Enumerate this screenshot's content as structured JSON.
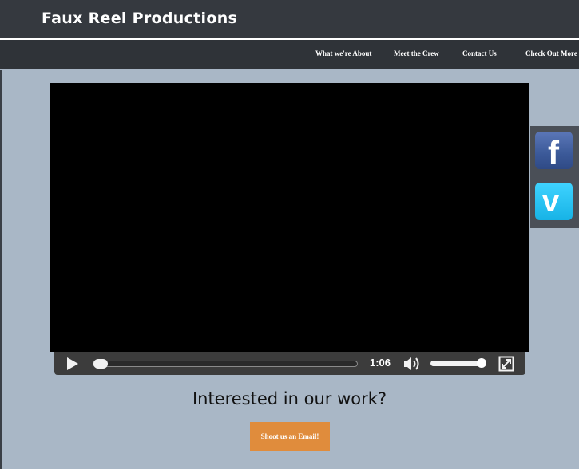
{
  "header": {
    "brand": "Faux Reel Productions"
  },
  "nav": {
    "items": [
      {
        "label": "What we're About"
      },
      {
        "label": "Meet the Crew"
      },
      {
        "label": "Contact Us"
      },
      {
        "label": "Check Out More"
      }
    ]
  },
  "video": {
    "time": "1:06",
    "progress": 0.0,
    "volume": 1.0,
    "controls": {
      "play_icon": "play-icon",
      "volume_icon": "volume-icon",
      "fullscreen_icon": "fullscreen-icon"
    }
  },
  "social": {
    "facebook": {
      "label": "f",
      "icon": "facebook-icon",
      "color": "#3b5998"
    },
    "vimeo": {
      "label": "v",
      "icon": "vimeo-icon",
      "color": "#1ab7ea"
    }
  },
  "main": {
    "headline": "Interested in our work?",
    "cta_label": "Shoot us an Email!"
  },
  "colors": {
    "background": "#a9b7c6",
    "header": "#35393f",
    "navbar": "#2f3338",
    "accent": "#e08c3c"
  }
}
